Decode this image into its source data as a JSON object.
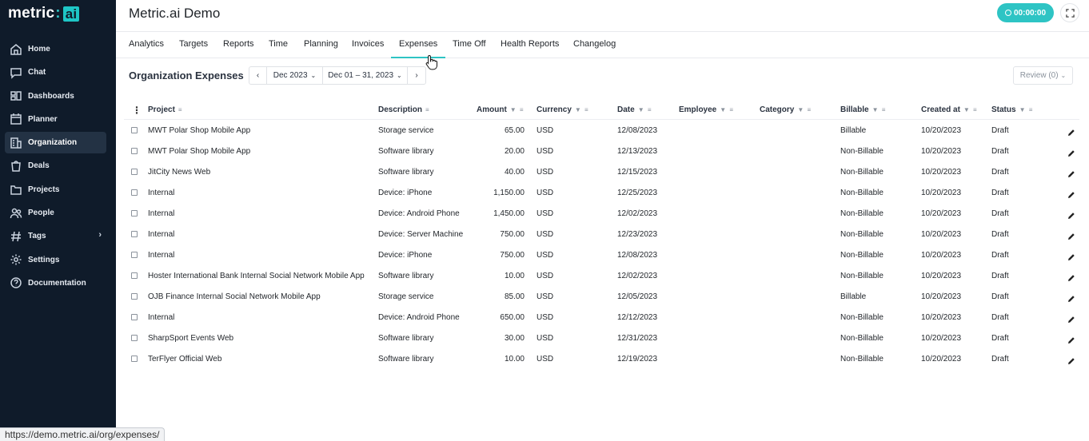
{
  "sidebar": {
    "logo": {
      "text": "metric",
      "badge": "ai"
    },
    "items": [
      {
        "label": "Home",
        "icon": "home-icon"
      },
      {
        "label": "Chat",
        "icon": "chat-icon"
      },
      {
        "label": "Dashboards",
        "icon": "dashboards-icon"
      },
      {
        "label": "Planner",
        "icon": "calendar-icon"
      },
      {
        "label": "Organization",
        "icon": "building-icon",
        "active": true
      },
      {
        "label": "Deals",
        "icon": "deals-icon"
      },
      {
        "label": "Projects",
        "icon": "folder-icon"
      },
      {
        "label": "People",
        "icon": "people-icon"
      },
      {
        "label": "Tags",
        "icon": "hash-icon",
        "expandable": true
      },
      {
        "label": "Settings",
        "icon": "gear-icon"
      },
      {
        "label": "Documentation",
        "icon": "help-icon"
      }
    ],
    "bottom_label": ""
  },
  "header": {
    "title": "Metric.ai Demo",
    "timer": "00:00:00",
    "accent": "#2ec4c4"
  },
  "tabs": [
    {
      "label": "Analytics"
    },
    {
      "label": "Targets"
    },
    {
      "label": "Reports"
    },
    {
      "label": "Time"
    },
    {
      "label": "Planning"
    },
    {
      "label": "Invoices"
    },
    {
      "label": "Expenses",
      "active": true
    },
    {
      "label": "Time Off"
    },
    {
      "label": "Health Reports"
    },
    {
      "label": "Changelog"
    }
  ],
  "toolbar": {
    "section_title": "Organization Expenses",
    "month": "Dec 2023",
    "range": "Dec 01 – 31, 2023",
    "review": "Review (0)"
  },
  "table": {
    "columns": [
      "Project",
      "Description",
      "Amount",
      "Currency",
      "Date",
      "Employee",
      "Category",
      "Billable",
      "Created at",
      "Status"
    ],
    "rows": [
      {
        "project": "MWT Polar Shop Mobile App",
        "description": "Storage service",
        "amount": "65.00",
        "currency": "USD",
        "date": "12/08/2023",
        "employee": "",
        "category": "",
        "billable": "Billable",
        "created": "10/20/2023",
        "status": "Draft"
      },
      {
        "project": "MWT Polar Shop Mobile App",
        "description": "Software library",
        "amount": "20.00",
        "currency": "USD",
        "date": "12/13/2023",
        "employee": "",
        "category": "",
        "billable": "Non-Billable",
        "created": "10/20/2023",
        "status": "Draft"
      },
      {
        "project": "JitCity News Web",
        "description": "Software library",
        "amount": "40.00",
        "currency": "USD",
        "date": "12/15/2023",
        "employee": "",
        "category": "",
        "billable": "Non-Billable",
        "created": "10/20/2023",
        "status": "Draft"
      },
      {
        "project": "Internal",
        "description": "Device: iPhone",
        "amount": "1,150.00",
        "currency": "USD",
        "date": "12/25/2023",
        "employee": "",
        "category": "",
        "billable": "Non-Billable",
        "created": "10/20/2023",
        "status": "Draft"
      },
      {
        "project": "Internal",
        "description": "Device: Android Phone",
        "amount": "1,450.00",
        "currency": "USD",
        "date": "12/02/2023",
        "employee": "",
        "category": "",
        "billable": "Non-Billable",
        "created": "10/20/2023",
        "status": "Draft"
      },
      {
        "project": "Internal",
        "description": "Device: Server Machine",
        "amount": "750.00",
        "currency": "USD",
        "date": "12/23/2023",
        "employee": "",
        "category": "",
        "billable": "Non-Billable",
        "created": "10/20/2023",
        "status": "Draft"
      },
      {
        "project": "Internal",
        "description": "Device: iPhone",
        "amount": "750.00",
        "currency": "USD",
        "date": "12/08/2023",
        "employee": "",
        "category": "",
        "billable": "Non-Billable",
        "created": "10/20/2023",
        "status": "Draft"
      },
      {
        "project": "Hoster International Bank Internal Social Network Mobile App",
        "description": "Software library",
        "amount": "10.00",
        "currency": "USD",
        "date": "12/02/2023",
        "employee": "",
        "category": "",
        "billable": "Non-Billable",
        "created": "10/20/2023",
        "status": "Draft"
      },
      {
        "project": "OJB Finance Internal Social Network Mobile App",
        "description": "Storage service",
        "amount": "85.00",
        "currency": "USD",
        "date": "12/05/2023",
        "employee": "",
        "category": "",
        "billable": "Billable",
        "created": "10/20/2023",
        "status": "Draft"
      },
      {
        "project": "Internal",
        "description": "Device: Android Phone",
        "amount": "650.00",
        "currency": "USD",
        "date": "12/12/2023",
        "employee": "",
        "category": "",
        "billable": "Non-Billable",
        "created": "10/20/2023",
        "status": "Draft"
      },
      {
        "project": "SharpSport Events Web",
        "description": "Software library",
        "amount": "30.00",
        "currency": "USD",
        "date": "12/31/2023",
        "employee": "",
        "category": "",
        "billable": "Non-Billable",
        "created": "10/20/2023",
        "status": "Draft"
      },
      {
        "project": "TerFlyer Official Web",
        "description": "Software library",
        "amount": "10.00",
        "currency": "USD",
        "date": "12/19/2023",
        "employee": "",
        "category": "",
        "billable": "Non-Billable",
        "created": "10/20/2023",
        "status": "Draft"
      }
    ]
  },
  "statusbar": {
    "url": "https://demo.metric.ai/org/expenses/"
  }
}
